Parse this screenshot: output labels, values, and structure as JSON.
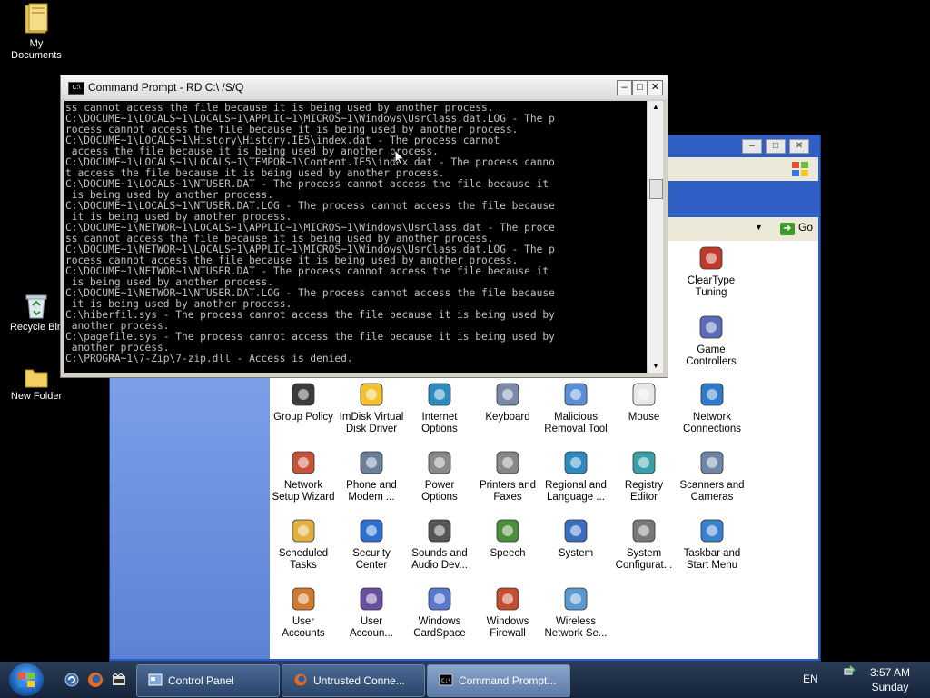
{
  "desktop": {
    "icons": [
      {
        "label": "My\nDocuments"
      },
      {
        "label": "Recycle Bin"
      },
      {
        "label": "New Folder"
      }
    ]
  },
  "control_panel": {
    "go_label": "Go",
    "items": [
      {
        "label": "ClearType\nTuning"
      },
      {
        "label": "Game\nControllers"
      },
      {
        "label": "Group Policy"
      },
      {
        "label": "ImDisk Virtual\nDisk Driver"
      },
      {
        "label": "Internet\nOptions"
      },
      {
        "label": "Keyboard"
      },
      {
        "label": "Malicious\nRemoval Tool"
      },
      {
        "label": "Mouse"
      },
      {
        "label": "Network\nConnections"
      },
      {
        "label": "Network\nSetup Wizard"
      },
      {
        "label": "Phone and\nModem ..."
      },
      {
        "label": "Power\nOptions"
      },
      {
        "label": "Printers and\nFaxes"
      },
      {
        "label": "Regional and\nLanguage ..."
      },
      {
        "label": "Registry\nEditor"
      },
      {
        "label": "Scanners and\nCameras"
      },
      {
        "label": "Scheduled\nTasks"
      },
      {
        "label": "Security\nCenter"
      },
      {
        "label": "Sounds and\nAudio Dev..."
      },
      {
        "label": "Speech"
      },
      {
        "label": "System"
      },
      {
        "label": "System\nConfigurat..."
      },
      {
        "label": "Taskbar and\nStart Menu"
      },
      {
        "label": "User\nAccounts"
      },
      {
        "label": "User\nAccoun..."
      },
      {
        "label": "Windows\nCardSpace"
      },
      {
        "label": "Windows\nFirewall"
      },
      {
        "label": "Wireless\nNetwork Se..."
      }
    ]
  },
  "cmd": {
    "title": "Command Prompt - RD C:\\ /S/Q",
    "output": "ss cannot access the file because it is being used by another process.\nC:\\DOCUME~1\\LOCALS~1\\LOCALS~1\\APPLIC~1\\MICROS~1\\Windows\\UsrClass.dat.LOG - The p\nrocess cannot access the file because it is being used by another process.\nC:\\DOCUME~1\\LOCALS~1\\History\\History.IE5\\index.dat - The process cannot\n access the file because it is being used by another process.\nC:\\DOCUME~1\\LOCALS~1\\LOCALS~1\\TEMPOR~1\\Content.IE5\\index.dat - The process canno\nt access the file because it is being used by another process.\nC:\\DOCUME~1\\LOCALS~1\\NTUSER.DAT - The process cannot access the file because it\n is being used by another process.\nC:\\DOCUME~1\\LOCALS~1\\NTUSER.DAT.LOG - The process cannot access the file because\n it is being used by another process.\nC:\\DOCUME~1\\NETWOR~1\\LOCALS~1\\APPLIC~1\\MICROS~1\\Windows\\UsrClass.dat - The proce\nss cannot access the file because it is being used by another process.\nC:\\DOCUME~1\\NETWOR~1\\LOCALS~1\\APPLIC~1\\MICROS~1\\Windows\\UsrClass.dat.LOG - The p\nrocess cannot access the file because it is being used by another process.\nC:\\DOCUME~1\\NETWOR~1\\NTUSER.DAT - The process cannot access the file because it\n is being used by another process.\nC:\\DOCUME~1\\NETWOR~1\\NTUSER.DAT.LOG - The process cannot access the file because\n it is being used by another process.\nC:\\hiberfil.sys - The process cannot access the file because it is being used by\n another process.\nC:\\pagefile.sys - The process cannot access the file because it is being used by\n another process.\nC:\\PROGRA~1\\7-Zip\\7-zip.dll - Access is denied."
  },
  "taskbar": {
    "tasks": [
      {
        "label": "Control Panel"
      },
      {
        "label": "Untrusted Conne..."
      },
      {
        "label": "Command Prompt..."
      }
    ],
    "language": "EN",
    "time": "3:57 AM",
    "day": "Sunday"
  }
}
